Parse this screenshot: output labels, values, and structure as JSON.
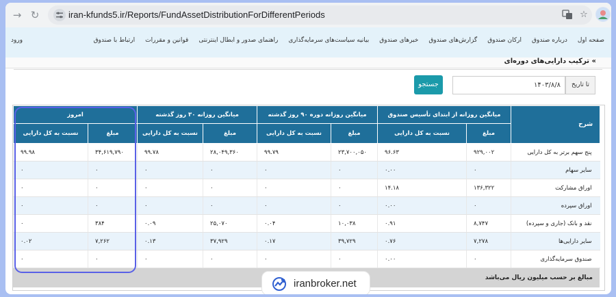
{
  "browser": {
    "url": "iran-kfunds5.ir/Reports/FundAssetDistributionForDifferentPeriods",
    "back_icon": "arrow-right-icon",
    "reload_icon": "reload-icon"
  },
  "nav": {
    "items": [
      "صفحه اول",
      "درباره صندوق",
      "ارکان صندوق",
      "گزارش‌های صندوق",
      "خبرهای صندوق",
      "بیانیه سیاست‌های سرمایه‌گذاری",
      "راهنمای صدور و ابطال اینترنتی",
      "قوانین و مقررات",
      "ارتباط با صندوق"
    ],
    "login": "ورود"
  },
  "page": {
    "breadcrumb_marker": "»",
    "title": "ترکیب دارایی‌های دوره‌ای"
  },
  "filter": {
    "to_date_label": "تا تاریخ",
    "date_value": "۱۴۰۳/۸/۸",
    "search_button": "جستجو"
  },
  "table": {
    "desc_header": "شرح",
    "groups": [
      "میانگین روزانه از ابتدای تأسیس صندوق",
      "میانگین روزانه دوره ۹۰ روز گذشته",
      "میانگین روزانه ۳۰ روز گذشته",
      "امروز"
    ],
    "sub_amount": "مبلغ",
    "sub_ratio": "نسبت به کل دارایی",
    "rows": [
      {
        "desc": "پنج سهم برتر به کل دارایی",
        "vals": [
          "۹۲۹,۰۰۲",
          "۹۶.۶۳",
          "۲۳,۷۰۰,۰۵۰",
          "۹۹.۷۹",
          "۲۸,۰۴۹,۳۶۰",
          "۹۹.۷۸",
          "۳۴,۶۱۹,۷۹۰",
          "۹۹.۹۸"
        ]
      },
      {
        "desc": "سایر سهام",
        "vals": [
          "۰",
          "۰.۰۰",
          "۰",
          "۰",
          "۰",
          "۰",
          "۰",
          "۰"
        ]
      },
      {
        "desc": "اوراق مشارکت",
        "vals": [
          "۱۳۶,۳۲۲",
          "۱۴.۱۸",
          "۰",
          "۰",
          "۰",
          "۰",
          "۰",
          "۰"
        ]
      },
      {
        "desc": "اوراق سپرده",
        "vals": [
          "۰",
          "۰.۰۰",
          "۰",
          "۰",
          "۰",
          "۰",
          "۰",
          "۰"
        ]
      },
      {
        "desc": "نقد و بانک (جاری و سپرده)",
        "vals": [
          "۸,۷۴۷",
          "۰.۹۱",
          "۱۰,۰۳۸",
          "۰.۰۴",
          "۲۵,۰۷۰",
          "۰.۰۹",
          "۳۸۴",
          "۰"
        ]
      },
      {
        "desc": "سایر دارایی‌ها",
        "vals": [
          "۷,۲۷۸",
          "۰.۷۶",
          "۳۹,۷۲۹",
          "۰.۱۷",
          "۳۷,۹۲۹",
          "۰.۱۳",
          "۷,۲۶۲",
          "۰.۰۲"
        ]
      },
      {
        "desc": "صندوق سرمایه‌گذاری",
        "vals": [
          "۰",
          "۰.۰۰",
          "۰",
          "۰",
          "۰",
          "۰",
          "۰",
          "۰"
        ]
      }
    ],
    "footer": "مبالغ بر حسب میلیون ریال می‌باشد"
  },
  "watermark": {
    "text": "iranbroker.net"
  },
  "colors": {
    "header_bg": "#1f6f9a",
    "search_bg": "#1b9aaa",
    "highlight": "#5960e6",
    "frame_bg": "#a9bff2"
  }
}
